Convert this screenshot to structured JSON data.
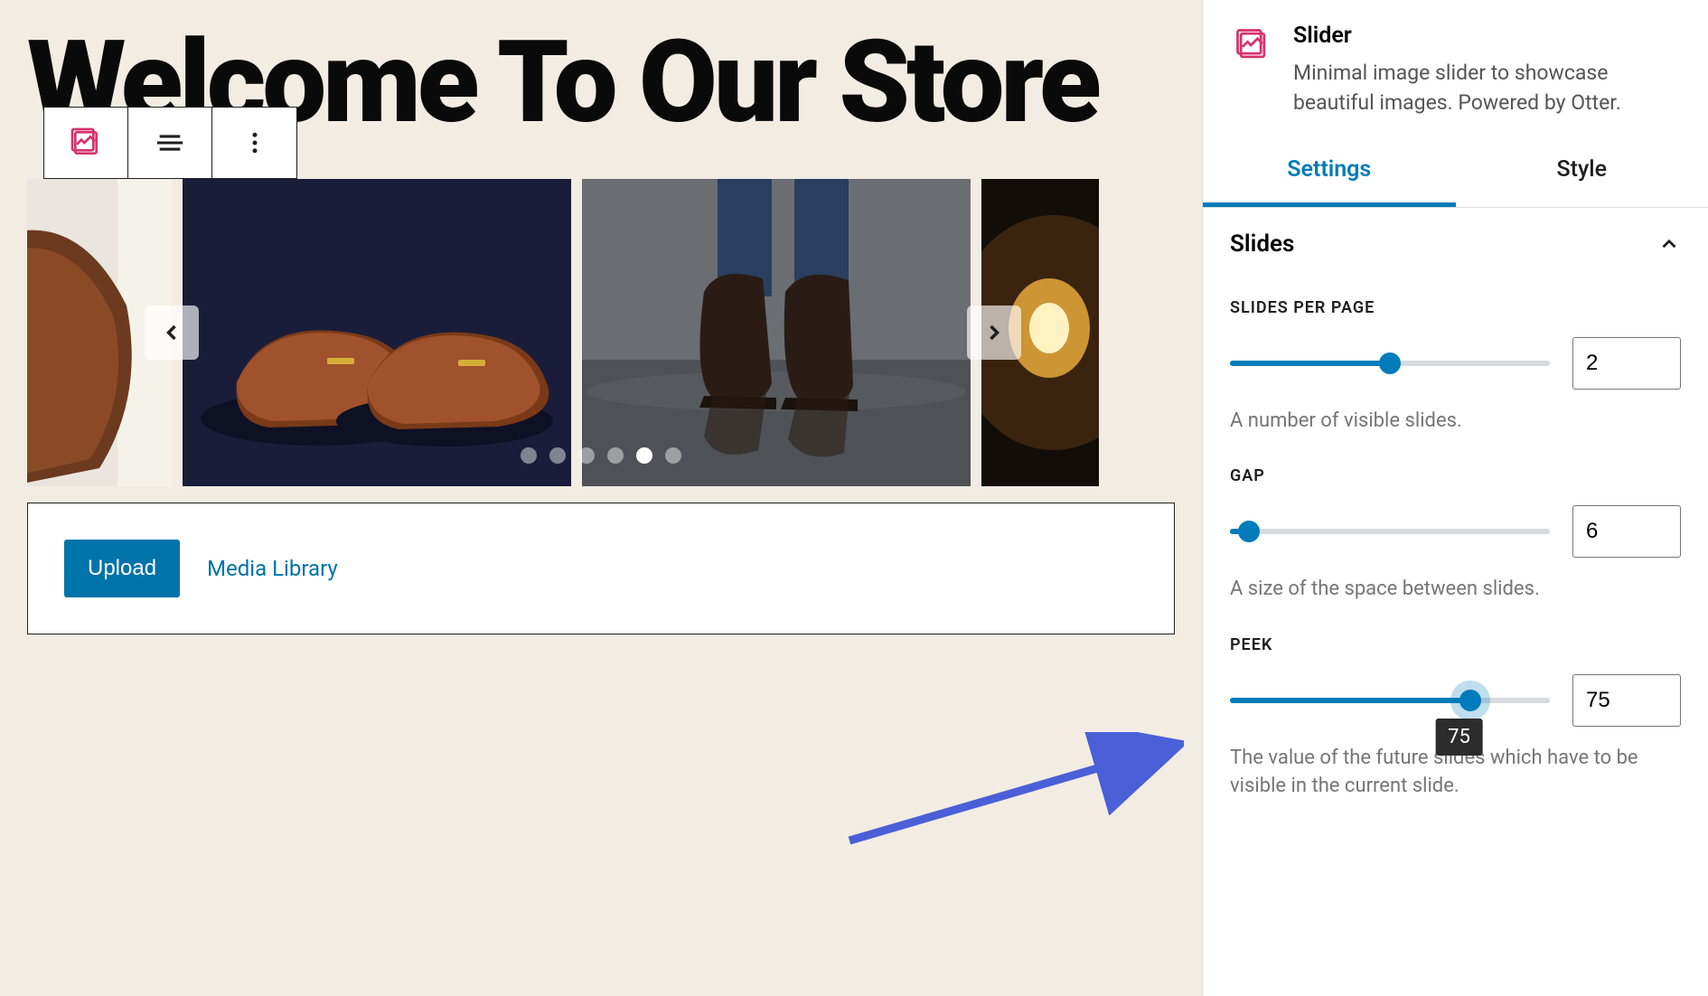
{
  "editor": {
    "page_title": "Welcome To Our Store",
    "media_panel": {
      "upload_label": "Upload",
      "library_label": "Media Library"
    },
    "slider_dots": {
      "count": 6,
      "active_index": 4
    }
  },
  "sidebar": {
    "block_name": "Slider",
    "block_description": "Minimal image slider to showcase beautiful images. Powered by Otter.",
    "tabs": [
      {
        "label": "Settings",
        "active": true
      },
      {
        "label": "Style",
        "active": false
      }
    ],
    "section_title": "Slides",
    "controls": {
      "slides_per_page": {
        "label": "SLIDES PER PAGE",
        "value": "2",
        "percent": 50,
        "help": "A number of visible slides."
      },
      "gap": {
        "label": "GAP",
        "value": "6",
        "percent": 6,
        "help": "A size of the space between slides."
      },
      "peek": {
        "label": "PEEK",
        "value": "75",
        "percent": 75,
        "tooltip": "75",
        "help": "The value of the future slides which have to be visible in the current slide."
      }
    }
  }
}
